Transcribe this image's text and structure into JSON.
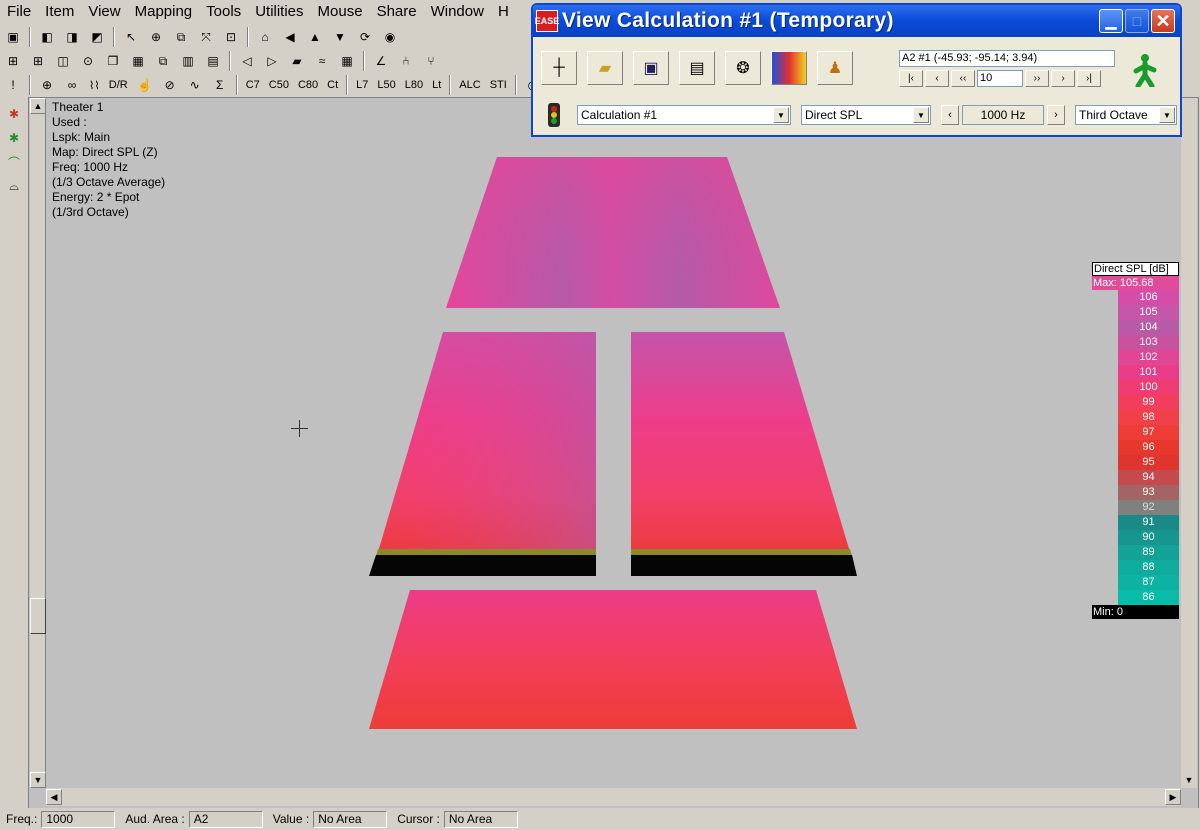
{
  "menu": [
    "File",
    "Item",
    "View",
    "Mapping",
    "Tools",
    "Utilities",
    "Mouse",
    "Share",
    "Window",
    "H"
  ],
  "toolbar3_text": [
    "D/R",
    "C7",
    "C50",
    "C80",
    "Ct",
    "L7",
    "L50",
    "L80",
    "Lt",
    "ALC",
    "STI"
  ],
  "view_info": [
    "Theater 1",
    "Used :",
    "Lspk: Main",
    "Map: Direct SPL (Z)",
    "Freq: 1000 Hz",
    "(1/3 Octave Average)",
    "Energy: 2 * Epot",
    "(1/3rd Octave)"
  ],
  "legend": {
    "title": "Direct SPL [dB]",
    "max_label": "Max: 105.68",
    "min_label": "Min: 0",
    "max_color": "#e04c9a",
    "scale": [
      {
        "value": "106",
        "color": "#d54da6"
      },
      {
        "value": "105",
        "color": "#c556a8"
      },
      {
        "value": "104",
        "color": "#b95aa6"
      },
      {
        "value": "103",
        "color": "#c9529e"
      },
      {
        "value": "102",
        "color": "#e04693"
      },
      {
        "value": "101",
        "color": "#ea3c88"
      },
      {
        "value": "100",
        "color": "#f03c73"
      },
      {
        "value": "99",
        "color": "#f23e5c"
      },
      {
        "value": "98",
        "color": "#f24048"
      },
      {
        "value": "97",
        "color": "#ee3c36"
      },
      {
        "value": "96",
        "color": "#e8382e"
      },
      {
        "value": "95",
        "color": "#e0342f"
      },
      {
        "value": "94",
        "color": "#c44a4e"
      },
      {
        "value": "93",
        "color": "#a46466"
      },
      {
        "value": "92",
        "color": "#808080"
      },
      {
        "value": "91",
        "color": "#1a8a86"
      },
      {
        "value": "90",
        "color": "#16968e"
      },
      {
        "value": "89",
        "color": "#12a296"
      },
      {
        "value": "88",
        "color": "#0fab9c"
      },
      {
        "value": "87",
        "color": "#0cb3a2"
      },
      {
        "value": "86",
        "color": "#0abca8"
      }
    ]
  },
  "calc_window": {
    "title": "View Calculation #1 (Temporary)",
    "app_icon_text": "EASE",
    "position_readout": "A2 #1  (-45.93; -95.14; 3.94)",
    "step_value": "10",
    "calculation_select": "Calculation #1",
    "map_type_select": "Direct SPL",
    "frequency": "1000 Hz",
    "band_select": "Third Octave"
  },
  "status": {
    "freq_label": "Freq.:",
    "freq_value": "1000",
    "aud_area_label": "Aud. Area :",
    "aud_area_value": "A2",
    "value_label": "Value :",
    "value_value": "No Area",
    "cursor_label": "Cursor :",
    "cursor_value": "No Area"
  }
}
